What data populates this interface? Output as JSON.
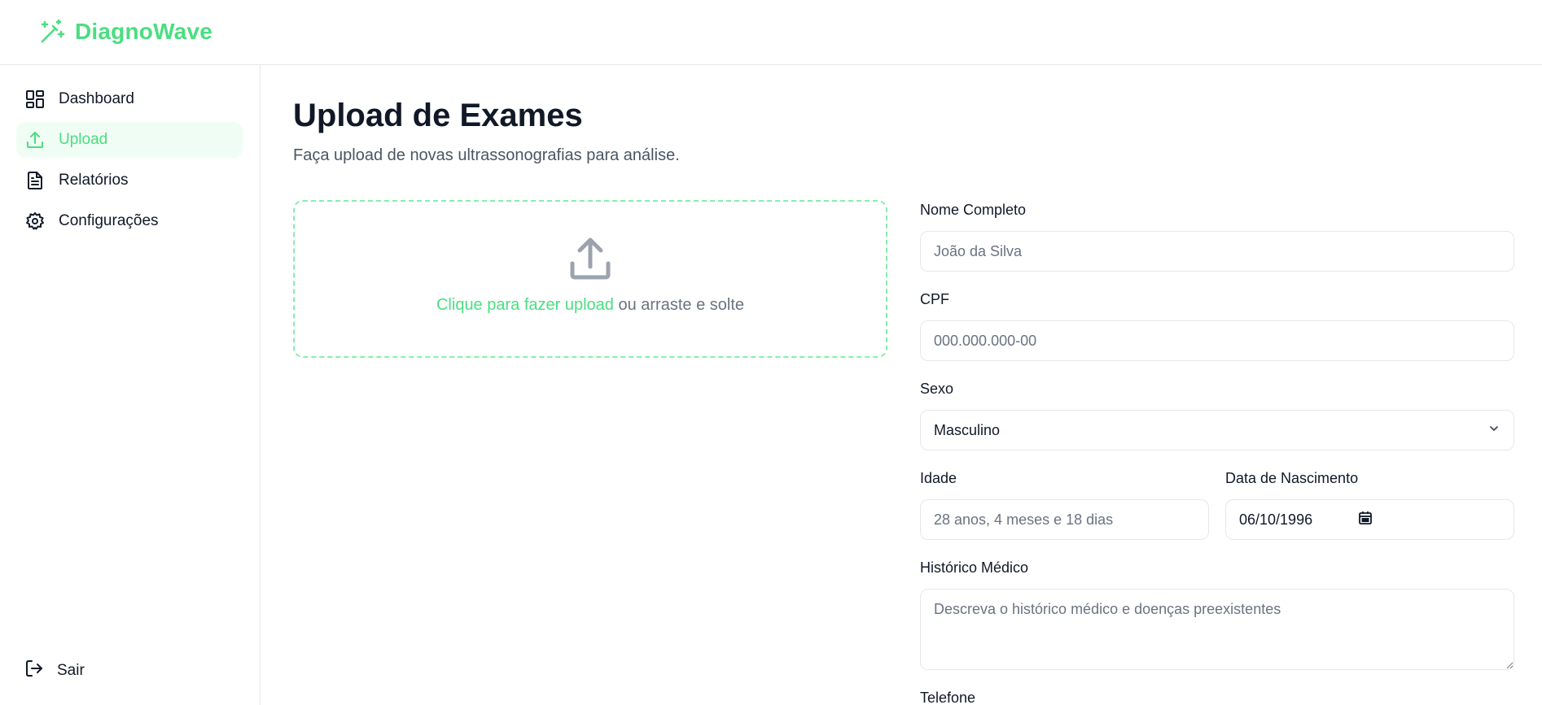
{
  "brand": {
    "name": "DiagnoWave",
    "color": "#4ade80"
  },
  "sidebar": {
    "items": [
      {
        "label": "Dashboard",
        "icon": "dashboard-icon",
        "active": false
      },
      {
        "label": "Upload",
        "icon": "upload-icon",
        "active": true
      },
      {
        "label": "Relatórios",
        "icon": "document-icon",
        "active": false
      },
      {
        "label": "Configurações",
        "icon": "gear-icon",
        "active": false
      }
    ],
    "logout_label": "Sair"
  },
  "main": {
    "title": "Upload de Exames",
    "subtitle": "Faça upload de novas ultrassonografias para análise.",
    "dropzone": {
      "link_text": "Clique para fazer upload",
      "rest_text": " ou arraste e solte"
    }
  },
  "form": {
    "name": {
      "label": "Nome Completo",
      "placeholder": "João da Silva"
    },
    "cpf": {
      "label": "CPF",
      "placeholder": "000.000.000-00"
    },
    "sex": {
      "label": "Sexo",
      "value": "Masculino"
    },
    "age": {
      "label": "Idade",
      "placeholder": "28 anos, 4 meses e 18 dias"
    },
    "birth": {
      "label": "Data de Nascimento",
      "value": "06/10/1996"
    },
    "history": {
      "label": "Histórico Médico",
      "placeholder": "Descreva o histórico médico e doenças preexistentes"
    },
    "phone": {
      "label": "Telefone"
    }
  },
  "colors": {
    "accent": "#4ade80",
    "active_bg": "#f0fdf4",
    "border": "#e5e7eb"
  }
}
